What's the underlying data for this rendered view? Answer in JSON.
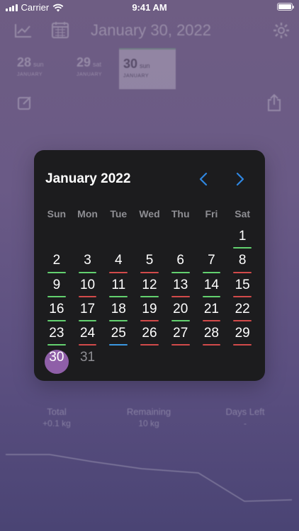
{
  "status_bar": {
    "carrier": "Carrier",
    "time": "9:41 AM",
    "battery_level": 1.0
  },
  "background": {
    "date_title": "January 30, 2022",
    "day_cards": [
      {
        "num": "28",
        "unit": "sun",
        "month": "JANUARY"
      },
      {
        "num": "29",
        "unit": "sat",
        "month": "JANUARY"
      },
      {
        "num": "30",
        "unit": "sun",
        "month": "JANUARY",
        "selected": true
      }
    ],
    "stats": [
      {
        "label": "Total",
        "value": "+0.1 kg"
      },
      {
        "label": "Remaining",
        "value": "10 kg"
      },
      {
        "label": "Days Left",
        "value": "-"
      }
    ]
  },
  "calendar": {
    "title": "January 2022",
    "prev_icon": "chevron-left-icon",
    "next_icon": "chevron-right-icon",
    "accent": "#2f86e0",
    "weekdays": [
      "Sun",
      "Mon",
      "Tue",
      "Wed",
      "Thu",
      "Fri",
      "Sat"
    ],
    "first_weekday_index": 6,
    "days": [
      {
        "n": "1",
        "status": "green"
      },
      {
        "n": "2",
        "status": "green"
      },
      {
        "n": "3",
        "status": "green"
      },
      {
        "n": "4",
        "status": "red"
      },
      {
        "n": "5",
        "status": "red"
      },
      {
        "n": "6",
        "status": "green"
      },
      {
        "n": "7",
        "status": "green"
      },
      {
        "n": "8",
        "status": "red"
      },
      {
        "n": "9",
        "status": "green"
      },
      {
        "n": "10",
        "status": "red"
      },
      {
        "n": "11",
        "status": "green"
      },
      {
        "n": "12",
        "status": "green"
      },
      {
        "n": "13",
        "status": "red"
      },
      {
        "n": "14",
        "status": "green"
      },
      {
        "n": "15",
        "status": "red"
      },
      {
        "n": "16",
        "status": "green"
      },
      {
        "n": "17",
        "status": "green"
      },
      {
        "n": "18",
        "status": "green"
      },
      {
        "n": "19",
        "status": "red"
      },
      {
        "n": "20",
        "status": "green"
      },
      {
        "n": "21",
        "status": "red"
      },
      {
        "n": "22",
        "status": "red"
      },
      {
        "n": "23",
        "status": "green"
      },
      {
        "n": "24",
        "status": "red"
      },
      {
        "n": "25",
        "status": "blue"
      },
      {
        "n": "26",
        "status": "red"
      },
      {
        "n": "27",
        "status": "red"
      },
      {
        "n": "28",
        "status": "red"
      },
      {
        "n": "29",
        "status": "red"
      },
      {
        "n": "30",
        "status": "selected"
      },
      {
        "n": "31",
        "status": "muted"
      }
    ],
    "colors": {
      "green": "#63d16f",
      "red": "#d24a4a",
      "blue": "#3a97e0",
      "selected": "#8f5fa8"
    }
  }
}
